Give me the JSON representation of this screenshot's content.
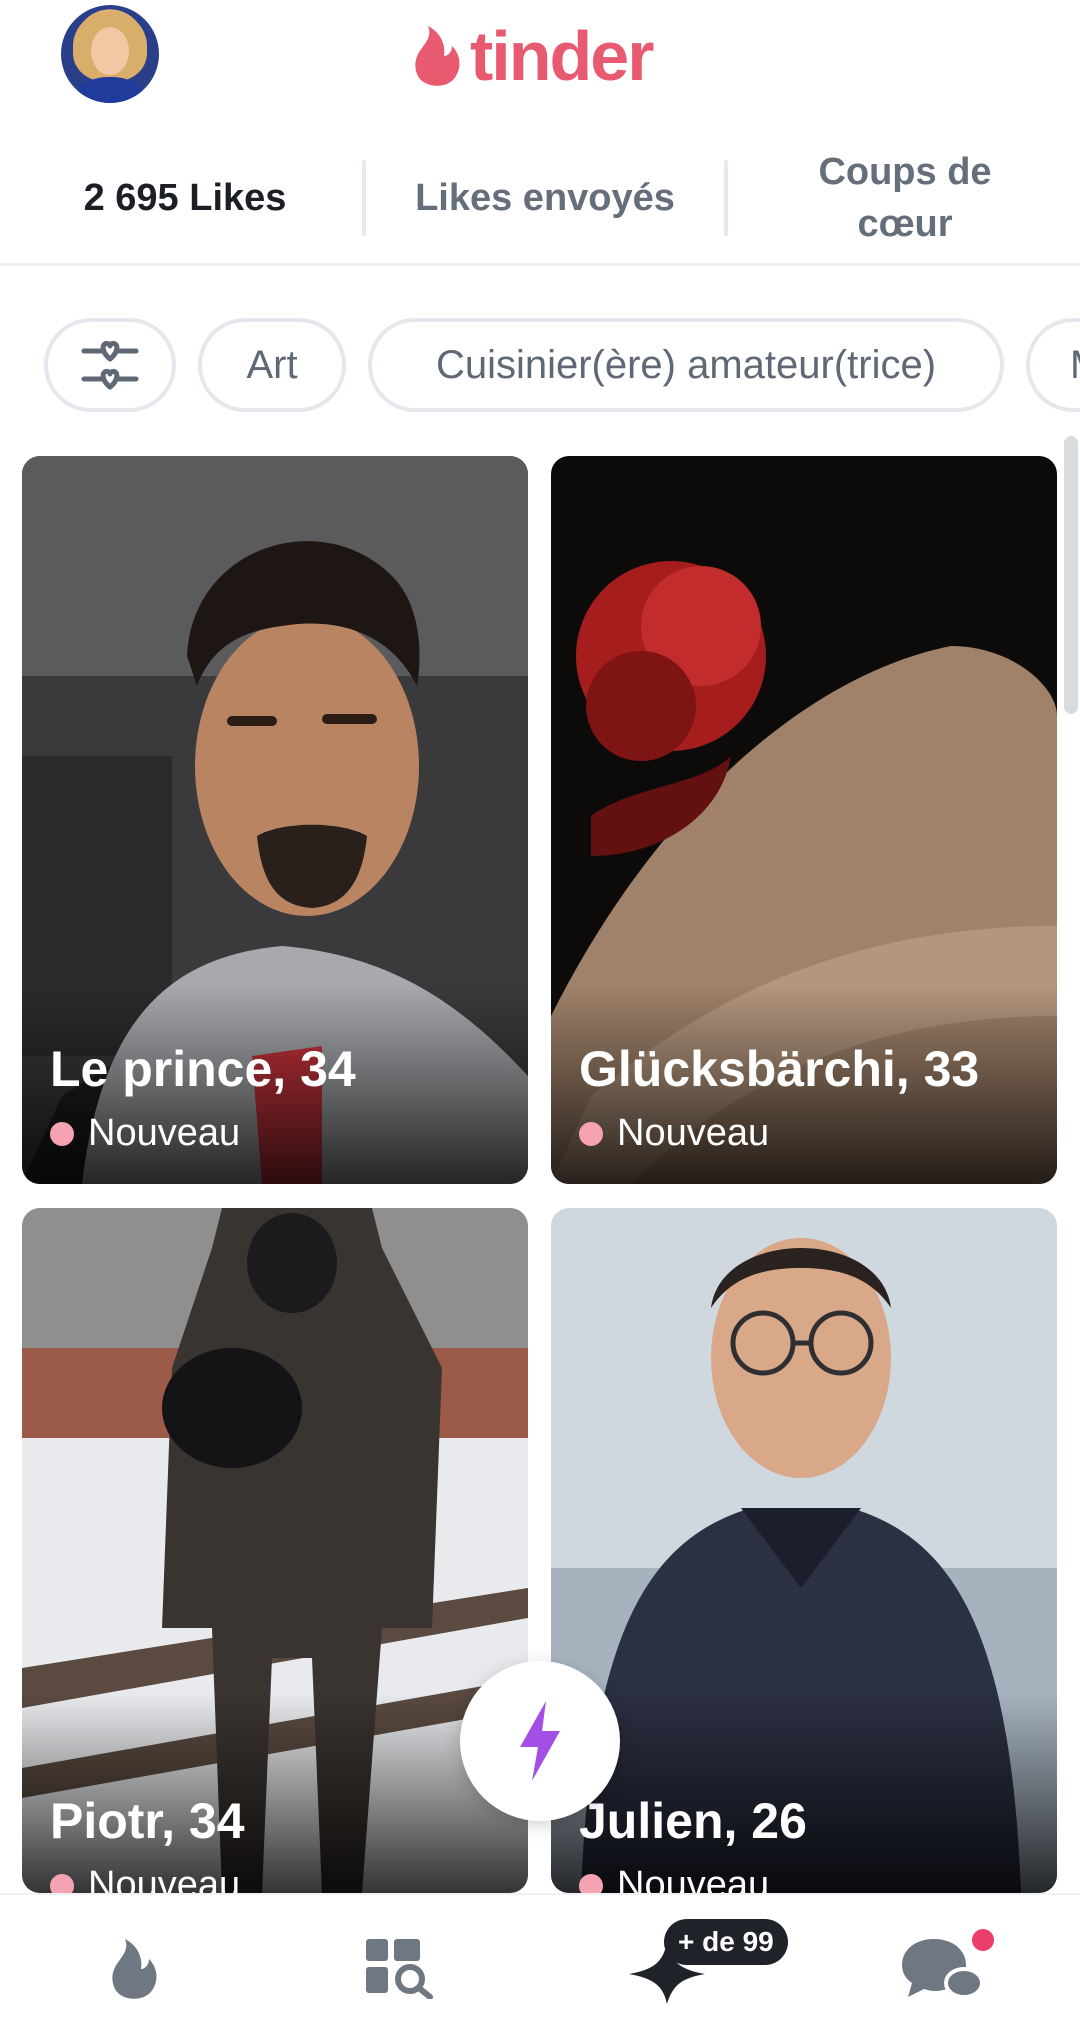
{
  "app": {
    "logo_text": "tinder",
    "brand_color": "#e85a6f"
  },
  "header": {
    "avatar_icon": "user-avatar"
  },
  "tabs": [
    {
      "label": "2 695 Likes",
      "active": true
    },
    {
      "label": "Likes envoyés",
      "active": false
    },
    {
      "label": "Coups de\ncœur",
      "active": false
    }
  ],
  "filters": {
    "filter_icon": "hearts-slider-icon",
    "chips": [
      "Art",
      "Cuisinier(ère) amateur(trice)",
      "M"
    ]
  },
  "cards": [
    {
      "name": "Le prince, 34",
      "status": "Nouveau"
    },
    {
      "name": "Glücksbärchi, 33",
      "status": "Nouveau"
    },
    {
      "name": "Piotr, 34",
      "status": "Nouveau"
    },
    {
      "name": "Julien, 26",
      "status": "Nouveau"
    }
  ],
  "boost": {
    "icon": "lightning-bolt-icon",
    "color": "#a34fe6"
  },
  "bottom_nav": {
    "items": [
      "flame-icon",
      "explore-grid-icon",
      "likes-sparkle-icon",
      "chat-bubbles-icon"
    ],
    "likes_badge": "+ de 99",
    "notif_color": "#ec3e6b",
    "icon_color": "#6f7783"
  }
}
